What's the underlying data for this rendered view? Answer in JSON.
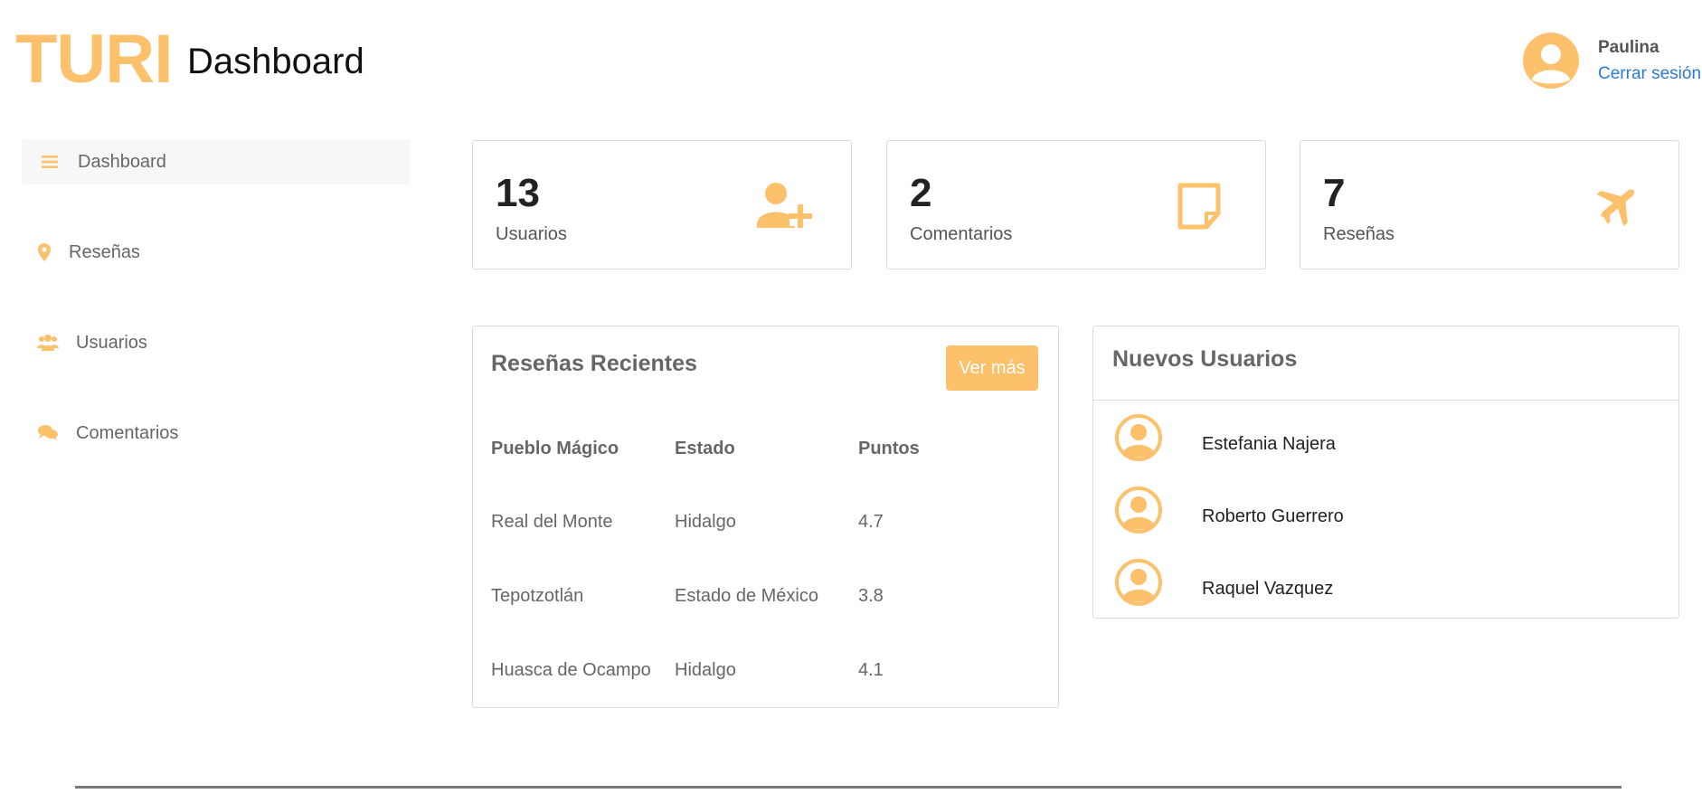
{
  "brand": {
    "name": "TURI",
    "accent_color": "#fdc06b"
  },
  "header": {
    "title": "Dashboard"
  },
  "user": {
    "name": "Paulina",
    "logout_label": "Cerrar sesión",
    "avatar_icon": "user-avatar-icon"
  },
  "sidebar": {
    "items": [
      {
        "label": "Dashboard",
        "icon": "menu-icon",
        "active": true
      },
      {
        "label": "Reseñas",
        "icon": "map-pin-icon",
        "active": false
      },
      {
        "label": "Usuarios",
        "icon": "users-icon",
        "active": false
      },
      {
        "label": "Comentarios",
        "icon": "comments-icon",
        "active": false
      }
    ]
  },
  "stats": [
    {
      "value": "13",
      "label": "Usuarios",
      "icon": "user-plus-icon"
    },
    {
      "value": "2",
      "label": "Comentarios",
      "icon": "sticky-note-icon"
    },
    {
      "value": "7",
      "label": "Reseñas",
      "icon": "plane-icon"
    }
  ],
  "recent_reviews": {
    "title": "Reseñas Recientes",
    "more_label": "Ver más",
    "columns": [
      "Pueblo Mágico",
      "Estado",
      "Puntos"
    ],
    "rows": [
      [
        "Real del Monte",
        "Hidalgo",
        "4.7"
      ],
      [
        "Tepotzotlán",
        "Estado de México",
        "3.8"
      ],
      [
        "Huasca de Ocampo",
        "Hidalgo",
        "4.1"
      ]
    ]
  },
  "new_users": {
    "title": "Nuevos Usuarios",
    "users": [
      {
        "name": "Estefania Najera"
      },
      {
        "name": "Roberto Guerrero"
      },
      {
        "name": "Raquel Vazquez"
      }
    ]
  }
}
